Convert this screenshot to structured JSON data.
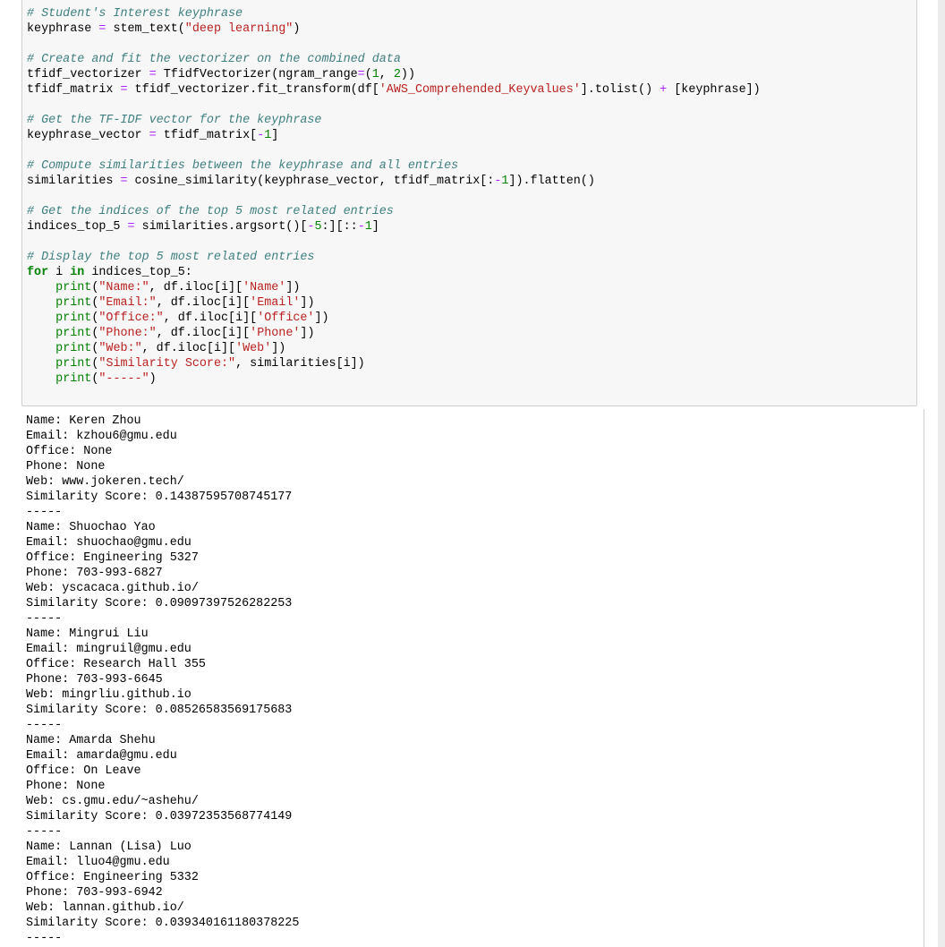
{
  "code_cell": {
    "lines": [
      {
        "c": "# Student's Interest keyphrase"
      },
      {
        "p": [
          "keyphrase ",
          "= ",
          "stem_text(",
          "\"deep learning\"",
          ")"
        ]
      },
      {
        "blank": true
      },
      {
        "c": "# Create and fit the vectorizer on the combined data"
      },
      {
        "p": [
          "tfidf_vectorizer ",
          "= ",
          "TfidfVectorizer(ngram_range",
          "=",
          "(",
          "1",
          ", ",
          "2",
          "))"
        ]
      },
      {
        "p": [
          "tfidf_matrix ",
          "= ",
          "tfidf_vectorizer.fit_transform(df[",
          "'AWS_Comprehended_Keyvalues'",
          "].tolist() ",
          "+ ",
          "[keyphrase])"
        ]
      },
      {
        "blank": true
      },
      {
        "c": "# Get the TF-IDF vector for the keyphrase"
      },
      {
        "p": [
          "keyphrase_vector ",
          "= ",
          "tfidf_matrix[",
          "-",
          "1",
          "]"
        ]
      },
      {
        "blank": true
      },
      {
        "c": "# Compute similarities between the keyphrase and all entries"
      },
      {
        "p": [
          "similarities ",
          "= ",
          "cosine_similarity(keyphrase_vector, tfidf_matrix[:",
          "-",
          "1",
          "]).flatten()"
        ]
      },
      {
        "blank": true
      },
      {
        "c": "# Get the indices of the top 5 most related entries"
      },
      {
        "p": [
          "indices_top_5 ",
          "= ",
          "similarities.argsort()[",
          "-",
          "5",
          ":][::",
          "-",
          "1",
          "]"
        ]
      },
      {
        "blank": true
      },
      {
        "c": "# Display the top 5 most related entries"
      },
      {
        "p": [
          "for",
          " i ",
          "in",
          " indices_top_5:"
        ]
      },
      {
        "p": [
          "    ",
          "print",
          "(",
          "\"Name:\"",
          ", df.iloc[i][",
          "'Name'",
          "])"
        ]
      },
      {
        "p": [
          "    ",
          "print",
          "(",
          "\"Email:\"",
          ", df.iloc[i][",
          "'Email'",
          "])"
        ]
      },
      {
        "p": [
          "    ",
          "print",
          "(",
          "\"Office:\"",
          ", df.iloc[i][",
          "'Office'",
          "])"
        ]
      },
      {
        "p": [
          "    ",
          "print",
          "(",
          "\"Phone:\"",
          ", df.iloc[i][",
          "'Phone'",
          "])"
        ]
      },
      {
        "p": [
          "    ",
          "print",
          "(",
          "\"Web:\"",
          ", df.iloc[i][",
          "'Web'",
          "])"
        ]
      },
      {
        "p": [
          "    ",
          "print",
          "(",
          "\"Similarity Score:\"",
          ", similarities[i])"
        ]
      },
      {
        "p": [
          "    ",
          "print",
          "(",
          "\"-----\"",
          ")"
        ]
      }
    ],
    "token_classes": {
      "1": [
        "",
        "op",
        "",
        "st",
        ""
      ],
      "4": [
        "",
        "op",
        "",
        "op",
        "",
        "nu",
        "",
        "nu",
        ""
      ],
      "5": [
        "",
        "op",
        "",
        "st",
        "",
        "op",
        ""
      ],
      "8": [
        "",
        "op",
        "",
        "op",
        "nu",
        ""
      ],
      "11": [
        "",
        "op",
        "",
        "op",
        "nu",
        ""
      ],
      "14": [
        "",
        "op",
        "",
        "op",
        "nu",
        "",
        "op",
        "nu",
        ""
      ],
      "17": [
        "kw",
        "",
        "kw",
        ""
      ],
      "18": [
        "",
        "bi",
        "",
        "st",
        "",
        "st",
        ""
      ],
      "19": [
        "",
        "bi",
        "",
        "st",
        "",
        "st",
        ""
      ],
      "20": [
        "",
        "bi",
        "",
        "st",
        "",
        "st",
        ""
      ],
      "21": [
        "",
        "bi",
        "",
        "st",
        "",
        "st",
        ""
      ],
      "22": [
        "",
        "bi",
        "",
        "st",
        "",
        "st",
        ""
      ],
      "23": [
        "",
        "bi",
        "",
        "st",
        ""
      ],
      "24": [
        "",
        "bi",
        "",
        "st",
        ""
      ]
    }
  },
  "output": {
    "entries": [
      {
        "name": "Keren Zhou",
        "email": "kzhou6@gmu.edu",
        "office": "None",
        "phone": "None",
        "web": "www.jokeren.tech/",
        "score": "0.14387595708745177"
      },
      {
        "name": "Shuochao Yao",
        "email": "shuochao@gmu.edu",
        "office": "Engineering 5327",
        "phone": "703-993-6827",
        "web": "yscacaca.github.io/",
        "score": "0.09097397526282253"
      },
      {
        "name": "Mingrui Liu",
        "email": "mingruil@gmu.edu",
        "office": "Research Hall 355",
        "phone": "703-993-6645",
        "web": "mingrliu.github.io",
        "score": "0.08526583569175683"
      },
      {
        "name": "Amarda Shehu",
        "email": "amarda@gmu.edu",
        "office": "On Leave",
        "phone": "None",
        "web": "cs.gmu.edu/~ashehu/",
        "score": "0.03972353568774149"
      },
      {
        "name": "Lannan (Lisa) Luo",
        "email": "lluo4@gmu.edu",
        "office": "Engineering 5332",
        "phone": "703-993-6942",
        "web": "lannan.github.io/",
        "score": "0.039340161180378225"
      }
    ],
    "labels": {
      "name": "Name: ",
      "email": "Email: ",
      "office": "Office: ",
      "phone": "Phone: ",
      "web": "Web: ",
      "score": "Similarity Score: "
    },
    "separator": "-----"
  }
}
